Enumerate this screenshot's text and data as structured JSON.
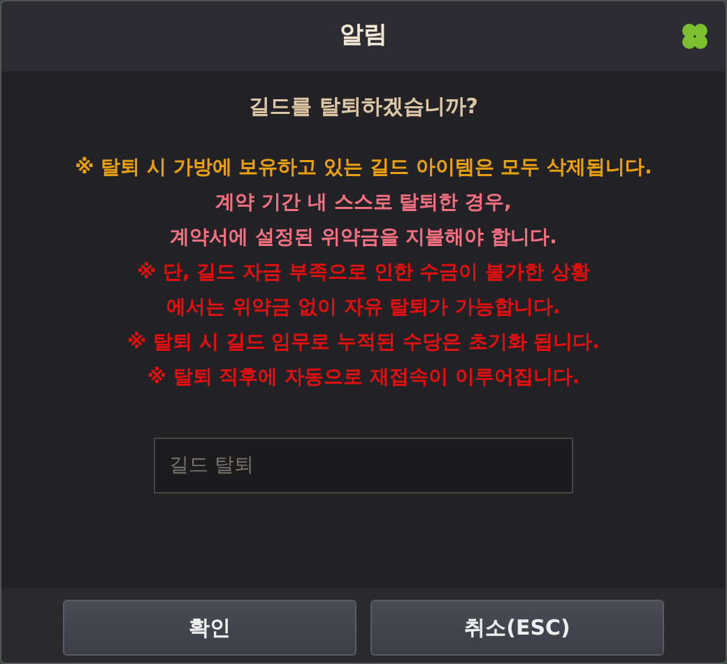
{
  "window": {
    "title": "알림"
  },
  "question": "길드를 탈퇴하겠습니까?",
  "notices": [
    {
      "text": "※ 탈퇴 시 가방에 보유하고 있는 길드 아이템은 모두 삭제됩니다.",
      "color": "#e8a010"
    },
    {
      "text": "계약 기간 내 스스로 탈퇴한 경우,",
      "color": "#f07080"
    },
    {
      "text": "계약서에 설정된 위약금을 지불해야 합니다.",
      "color": "#f07080"
    },
    {
      "text": "※ 단, 길드 자금 부족으로 인한 수금이 불가한 상황",
      "color": "#e01010"
    },
    {
      "text": "에서는 위약금 없이 자유 탈퇴가 가능합니다.",
      "color": "#e01010"
    },
    {
      "text": "※ 탈퇴 시 길드 임무로 누적된 수당은 초기화 됩니다.",
      "color": "#e01010"
    },
    {
      "text": "※ 탈퇴 직후에 자동으로 재접속이 이루어집니다.",
      "color": "#e01010"
    }
  ],
  "input": {
    "placeholder": "길드 탈퇴"
  },
  "buttons": [
    "확인",
    "취소(ESC)"
  ]
}
